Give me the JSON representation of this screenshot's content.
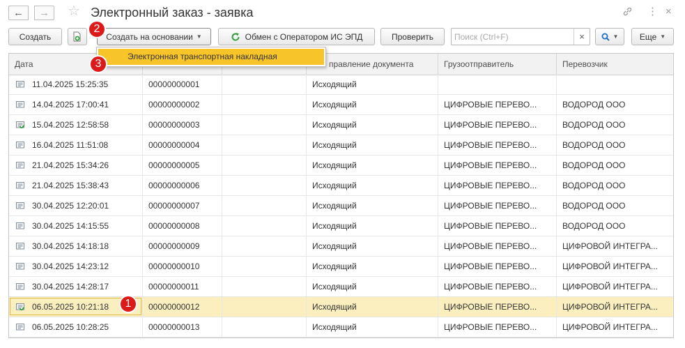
{
  "header": {
    "title": "Электронный заказ - заявка",
    "back_icon": "arrow-left-icon",
    "forward_icon": "arrow-right-icon",
    "favorite_icon": "star-icon",
    "link_icon": "link-icon",
    "menu_icon": "more-vertical-icon",
    "close_icon": "close-icon"
  },
  "toolbar": {
    "create_label": "Создать",
    "copy_icon": "copy-document-icon",
    "create_based_label": "Создать на основании",
    "exchange_label": "Обмен с Оператором ИС ЭПД",
    "check_label": "Проверить",
    "search_placeholder": "Поиск (Ctrl+F)",
    "search_value": "",
    "clear_label": "×",
    "find_icon": "search-icon",
    "more_label": "Еще"
  },
  "dropdown": {
    "items": [
      "Электронная транспортная накладная"
    ]
  },
  "markers": [
    "1",
    "2",
    "3"
  ],
  "table": {
    "columns": [
      "Дата",
      "",
      "",
      "Направление документа",
      "Грузоотправитель",
      "Перевозчик"
    ],
    "column_visible_labels": [
      "Дата",
      "",
      "",
      "правление документа",
      "Грузоотправитель",
      "Перевозчик"
    ],
    "rows": [
      {
        "date": "11.04.2025 15:25:35",
        "number": "00000000001",
        "direction": "Исходящий",
        "shipper": "",
        "carrier": "",
        "status": "plain"
      },
      {
        "date": "14.04.2025 17:00:41",
        "number": "00000000002",
        "direction": "Исходящий",
        "shipper": "ЦИФРОВЫЕ ПЕРЕВО...",
        "carrier": "ВОДОРОД ООО",
        "status": "plain"
      },
      {
        "date": "15.04.2025 12:58:58",
        "number": "00000000003",
        "direction": "Исходящий",
        "shipper": "ЦИФРОВЫЕ ПЕРЕВО...",
        "carrier": "ВОДОРОД ООО",
        "status": "posted"
      },
      {
        "date": "16.04.2025 11:51:08",
        "number": "00000000004",
        "direction": "Исходящий",
        "shipper": "ЦИФРОВЫЕ ПЕРЕВО...",
        "carrier": "ВОДОРОД ООО",
        "status": "plain"
      },
      {
        "date": "21.04.2025 15:34:26",
        "number": "00000000005",
        "direction": "Исходящий",
        "shipper": "ЦИФРОВЫЕ ПЕРЕВО...",
        "carrier": "ВОДОРОД ООО",
        "status": "plain"
      },
      {
        "date": "21.04.2025 15:38:43",
        "number": "00000000006",
        "direction": "Исходящий",
        "shipper": "ЦИФРОВЫЕ ПЕРЕВО...",
        "carrier": "ВОДОРОД ООО",
        "status": "plain"
      },
      {
        "date": "30.04.2025 12:20:01",
        "number": "00000000007",
        "direction": "Исходящий",
        "shipper": "ЦИФРОВЫЕ ПЕРЕВО...",
        "carrier": "ВОДОРОД ООО",
        "status": "plain"
      },
      {
        "date": "30.04.2025 14:15:55",
        "number": "00000000008",
        "direction": "Исходящий",
        "shipper": "ЦИФРОВЫЕ ПЕРЕВО...",
        "carrier": "ВОДОРОД ООО",
        "status": "plain"
      },
      {
        "date": "30.04.2025 14:18:18",
        "number": "00000000009",
        "direction": "Исходящий",
        "shipper": "ЦИФРОВЫЕ ПЕРЕВО...",
        "carrier": "ЦИФРОВОЙ ИНТЕГРА...",
        "status": "plain"
      },
      {
        "date": "30.04.2025 14:23:12",
        "number": "00000000010",
        "direction": "Исходящий",
        "shipper": "ЦИФРОВЫЕ ПЕРЕВО...",
        "carrier": "ЦИФРОВОЙ ИНТЕГРА...",
        "status": "plain"
      },
      {
        "date": "30.04.2025 14:28:17",
        "number": "00000000011",
        "direction": "Исходящий",
        "shipper": "ЦИФРОВЫЕ ПЕРЕВО...",
        "carrier": "ЦИФРОВОЙ ИНТЕГРА...",
        "status": "plain"
      },
      {
        "date": "06.05.2025 10:21:18",
        "number": "00000000012",
        "direction": "Исходящий",
        "shipper": "ЦИФРОВЫЕ ПЕРЕВО...",
        "carrier": "ЦИФРОВОЙ ИНТЕГРА...",
        "status": "posted"
      },
      {
        "date": "06.05.2025 10:28:25",
        "number": "00000000013",
        "direction": "Исходящий",
        "shipper": "ЦИФРОВЫЕ ПЕРЕВО...",
        "carrier": "ЦИФРОВОЙ ИНТЕГРА...",
        "status": "plain"
      }
    ]
  },
  "colors": {
    "selected_row": "#fbefc0",
    "dropdown_highlight": "#f7c42a",
    "marker": "#dc1a1a",
    "posted_check": "#2e9e3e",
    "exchange_icon": "#2e9e3e",
    "find_icon": "#1a6fc9"
  }
}
